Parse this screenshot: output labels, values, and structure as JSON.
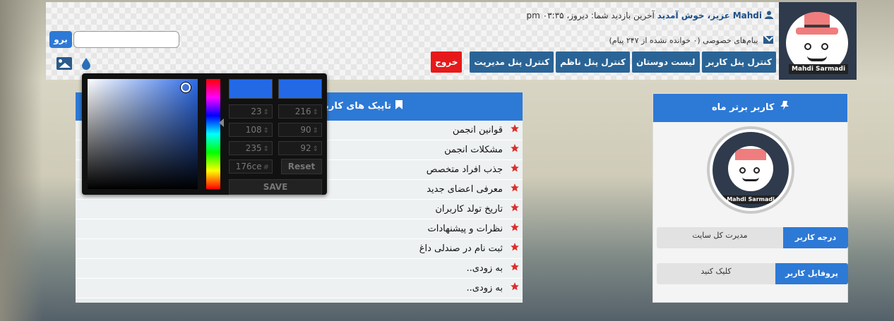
{
  "header": {
    "welcome": {
      "username": "Mahdi",
      "greeting": "عزیز، خوش آمدید",
      "last_visit": "آخرین بازدید شما: دیروز، ۰۳:۳۵ pm"
    },
    "messages": "پیام‌های خصوصی (۰ خوانده نشده از ۲۴۷ پیام)",
    "nav": [
      "کنترل پنل کاربر",
      "لیست دوستان",
      "کنترل پنل ناظم",
      "کنترل پنل مدیریت"
    ],
    "exit": "خروج",
    "go_button": "برو",
    "search_value": "",
    "avatar_caption": "Mahdi Sarmadi"
  },
  "topics": {
    "title": "تاپیک های کاربر",
    "items": [
      "قوانین انجمن",
      "مشکلات انجمن",
      "جذب افراد متخصص",
      "معرفی اعضای جدید",
      "تاریخ تولد کاربران",
      "نظرات و پیشنهادات",
      "ثبت نام در صندلی داغ",
      "به زودی..",
      "به زودی.."
    ]
  },
  "color_picker": {
    "swatch_color": "#2369e6",
    "fields": {
      "r": "23",
      "g": "108",
      "b": "235",
      "h": "216",
      "s": "90",
      "v": "92",
      "hex": "176ce"
    },
    "reset": "Reset",
    "save": "SAVE"
  },
  "widget": {
    "title": "کاربر برتر ماه",
    "avatar_caption": "Mahdi Sarmadi",
    "rows": [
      {
        "label": "درجه کاربر",
        "value": "مدیرت کل سایت"
      },
      {
        "label": "پروفایل کاربر",
        "value": "کلیک کنید"
      }
    ]
  },
  "colors": {
    "accent": "#2d79d6",
    "nav_button": "#2a6496",
    "exit_button": "#e61a1a",
    "star": "#d9302b"
  }
}
